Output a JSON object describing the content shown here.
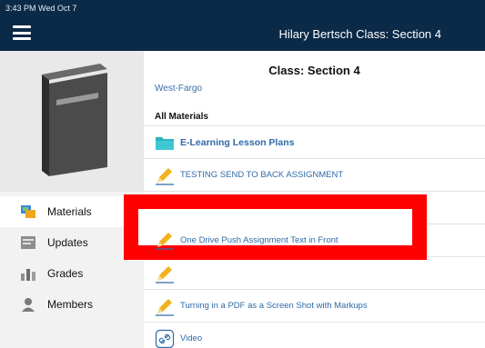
{
  "status_bar": {
    "time_date": "3:43 PM  Wed Oct 7"
  },
  "header": {
    "title": "Hilary Bertsch Class: Section 4",
    "menu_icon": "hamburger-menu-icon"
  },
  "sidebar": {
    "cover_icon": "book-icon",
    "items": [
      {
        "label": "Materials",
        "icon": "materials-icon",
        "active": true
      },
      {
        "label": "Updates",
        "icon": "updates-icon"
      },
      {
        "label": "Grades",
        "icon": "grades-icon"
      },
      {
        "label": "Members",
        "icon": "members-icon"
      }
    ]
  },
  "main": {
    "heading": "Class: Section 4",
    "school": "West-Fargo",
    "section_label": "All Materials",
    "items": [
      {
        "label": "E-Learning Lesson Plans",
        "icon": "folder-icon"
      },
      {
        "label": "TESTING SEND TO BACK ASSIGNMENT",
        "icon": "pencil-icon"
      },
      {
        "label": "",
        "icon": "pencil-icon"
      },
      {
        "label": "One Drive Push Assignment Text in Front",
        "icon": "pencil-icon"
      },
      {
        "label": "",
        "icon": "pencil-icon"
      },
      {
        "label": "Turning in a PDF as a Screen Shot with Markups",
        "icon": "pencil-icon"
      },
      {
        "label": "Video",
        "icon": "video-link-icon"
      }
    ]
  },
  "colors": {
    "header_bg": "#0b2a47",
    "link": "#2f6aa8",
    "highlight": "#ff0000",
    "folder": "#2bb3c0",
    "pencil": "#f2b21b"
  }
}
